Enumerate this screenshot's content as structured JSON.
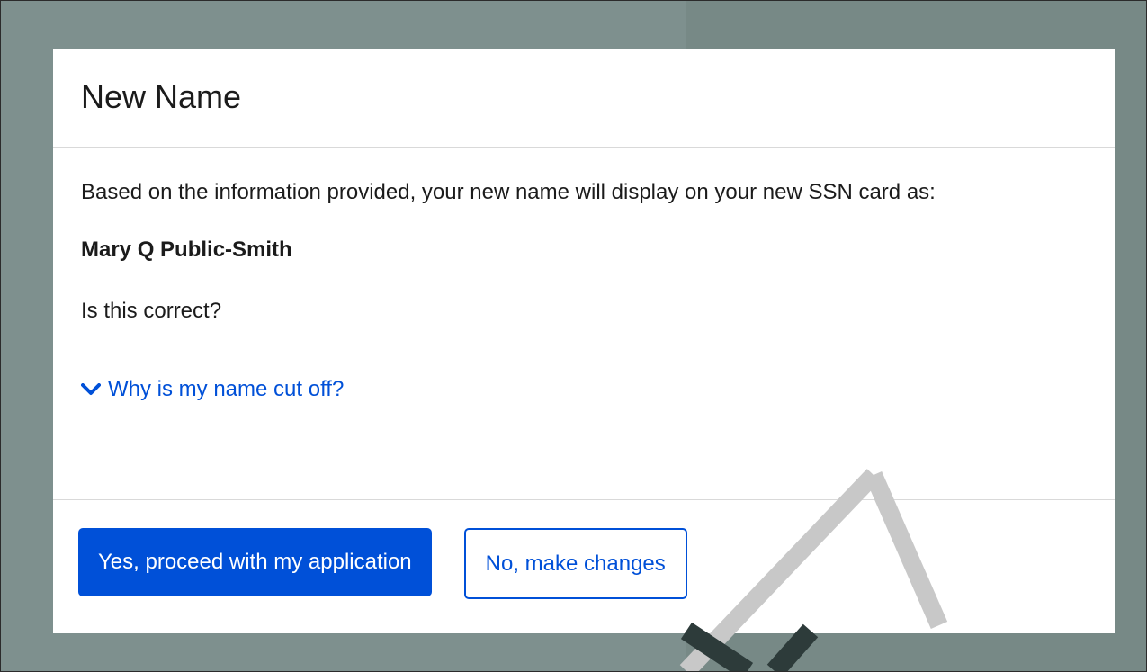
{
  "modal": {
    "title": "New Name",
    "intro": "Based on the information provided, your new name will display on your new SSN card as:",
    "name": "Mary Q Public-Smith",
    "question": "Is this correct?",
    "why_link": "Why is my name cut off?",
    "why_icon": "chevron-down-icon",
    "primary_button": "Yes, proceed with my application",
    "secondary_button": "No, make changes"
  },
  "colors": {
    "link": "#0050d8",
    "primary": "#0050d8",
    "overlay": "#7e908e",
    "text": "#1b1b1b"
  }
}
